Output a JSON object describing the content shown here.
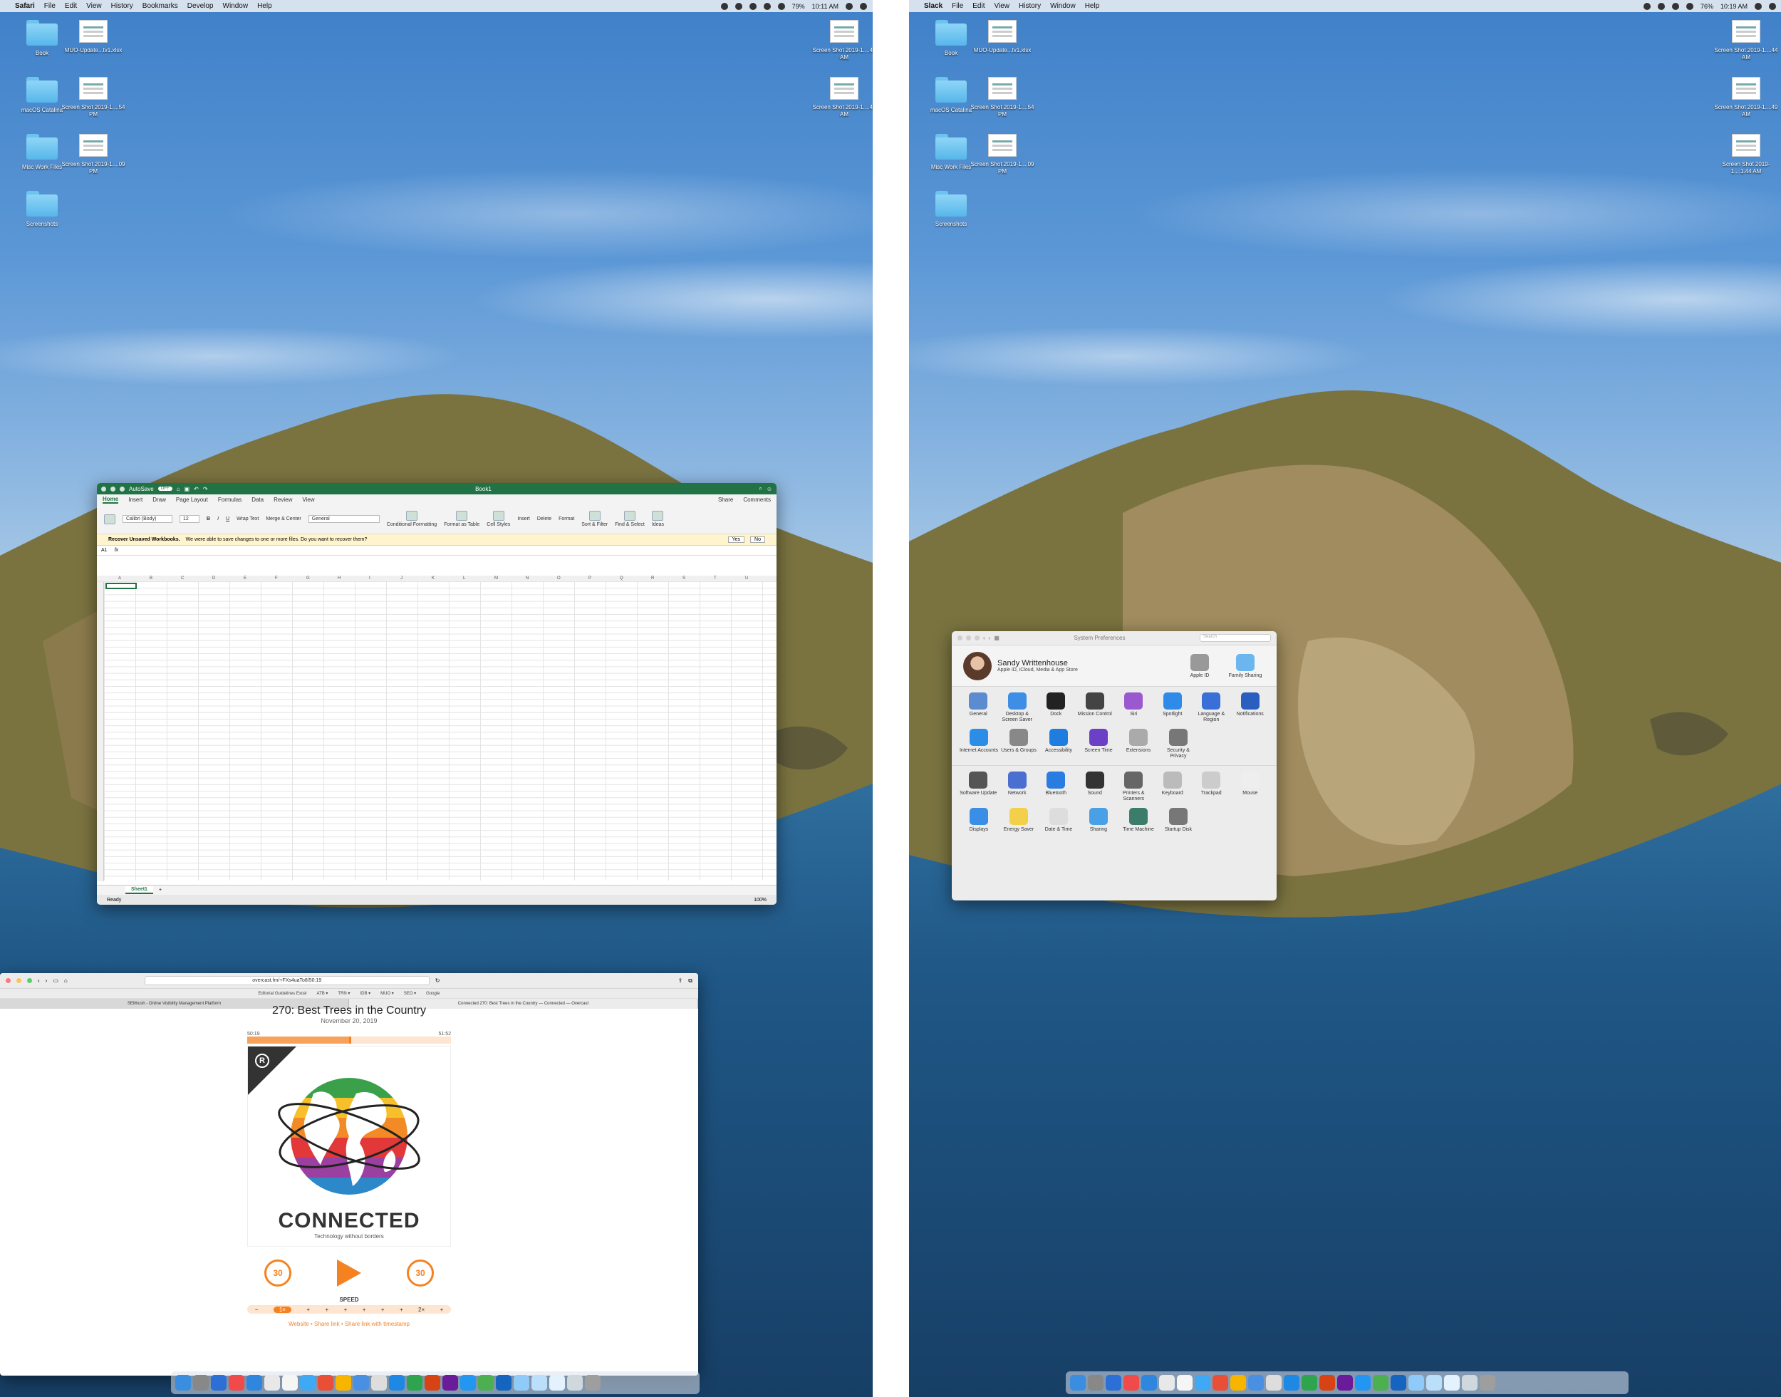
{
  "left": {
    "menubar": {
      "apple": "",
      "app": "Safari",
      "menus": [
        "File",
        "Edit",
        "View",
        "History",
        "Bookmarks",
        "Develop",
        "Window",
        "Help"
      ],
      "battery": "79%",
      "time": "10:11 AM"
    },
    "desktop_icons": [
      {
        "label": "Book",
        "kind": "folder"
      },
      {
        "label": "MUO-Update...tv1.xlsx",
        "kind": "doc"
      },
      {
        "label": "macOS Catalina",
        "kind": "folder"
      },
      {
        "label": "Screen Shot 2019-1....54 PM",
        "kind": "doc"
      },
      {
        "label": "Misc Work Files",
        "kind": "folder"
      },
      {
        "label": "Screen Shot 2019-1....09 PM",
        "kind": "doc"
      },
      {
        "label": "Screenshots",
        "kind": "folder"
      },
      {
        "label": "Screen Shot 2019-1....44 AM",
        "kind": "doc"
      },
      {
        "label": "Screen Shot 2019-1....49 AM",
        "kind": "doc"
      }
    ],
    "excel": {
      "autosave": "AutoSave",
      "autosave_state": "OFF",
      "title": "Book1",
      "tabs": [
        "Home",
        "Insert",
        "Draw",
        "Page Layout",
        "Formulas",
        "Data",
        "Review",
        "View"
      ],
      "share": "Share",
      "comments": "Comments",
      "font": "Calibri (Body)",
      "size": "12",
      "wrap": "Wrap Text",
      "merge": "Merge & Center",
      "number_format": "General",
      "ribbon_groups": [
        "Conditional Formatting",
        "Format as Table",
        "Cell Styles",
        "Insert",
        "Delete",
        "Format",
        "Sort & Filter",
        "Find & Select",
        "Ideas"
      ],
      "info_title": "Recover Unsaved Workbooks.",
      "info_text": "We were able to save changes to one or more files. Do you want to recover them?",
      "yes": "Yes",
      "no": "No",
      "namebox": "A1",
      "fx": "fx",
      "columns": [
        "A",
        "B",
        "C",
        "D",
        "E",
        "F",
        "G",
        "H",
        "I",
        "J",
        "K",
        "L",
        "M",
        "N",
        "O",
        "P",
        "Q",
        "R",
        "S",
        "T",
        "U"
      ],
      "sheet": "Sheet1",
      "status": "Ready",
      "zoom": "100%"
    },
    "safari": {
      "url": "overcast.fm/+FXs4uaTo8/50:19",
      "favorites": [
        "Editorial Guidelines Excel",
        "ATB ▾",
        "TRN ▾",
        "IDB ▾",
        "MUO ▾",
        "SEO ▾",
        "Google"
      ],
      "tabs": [
        "SEMrush - Online Visibility Management Platform",
        "Connected 270: Best Trees in the Country — Connected — Overcast"
      ],
      "episode_title": "270: Best Trees in the Country",
      "date": "November 20, 2019",
      "elapsed": "50:19",
      "remaining": "51:52",
      "progress": 0.5,
      "show": "CONNECTED",
      "tagline": "Technology without borders",
      "skip_back": "30",
      "skip_fwd": "30",
      "speed_label": "SPEED",
      "speed_steps": [
        "−",
        "1×",
        "+",
        "+",
        "+",
        "+",
        "+",
        "+",
        "2×",
        "+"
      ],
      "links": "Website • Share link • Share link with timestamp"
    }
  },
  "right": {
    "menubar": {
      "apple": "",
      "app": "Slack",
      "menus": [
        "File",
        "Edit",
        "View",
        "History",
        "Window",
        "Help"
      ],
      "battery": "76%",
      "time": "10:19 AM"
    },
    "desktop_icons": [
      {
        "label": "Book",
        "kind": "folder"
      },
      {
        "label": "MUO-Update...tv1.xlsx",
        "kind": "doc"
      },
      {
        "label": "macOS Catalina",
        "kind": "folder"
      },
      {
        "label": "Screen Shot 2019-1....54 PM",
        "kind": "doc"
      },
      {
        "label": "Misc Work Files",
        "kind": "folder"
      },
      {
        "label": "Screen Shot 2019-1....09 PM",
        "kind": "doc"
      },
      {
        "label": "Screenshots",
        "kind": "folder"
      },
      {
        "label": "Screen Shot 2019-1....44 AM",
        "kind": "doc"
      },
      {
        "label": "Screen Shot 2019-1....49 AM",
        "kind": "doc"
      },
      {
        "label": "Screen Shot 2019-1....1.44 AM",
        "kind": "doc"
      }
    ],
    "sysprefs": {
      "title": "System Preferences",
      "search": "Search",
      "user_name": "Sandy Writtenhouse",
      "user_sub": "Apple ID, iCloud, Media & App Store",
      "top_items": [
        "Apple ID",
        "Family Sharing"
      ],
      "row1": [
        {
          "label": "General",
          "color": "#5a8ccf"
        },
        {
          "label": "Desktop & Screen Saver",
          "color": "#3e8ee6"
        },
        {
          "label": "Dock",
          "color": "#222"
        },
        {
          "label": "Mission Control",
          "color": "#444"
        },
        {
          "label": "Siri",
          "color": "#9b59d0"
        },
        {
          "label": "Spotlight",
          "color": "#2f8be8"
        },
        {
          "label": "Language & Region",
          "color": "#3a6fd8"
        },
        {
          "label": "Notifications",
          "color": "#2a5fc0"
        }
      ],
      "row2": [
        {
          "label": "Internet Accounts",
          "color": "#2b8de6"
        },
        {
          "label": "Users & Groups",
          "color": "#888"
        },
        {
          "label": "Accessibility",
          "color": "#1f7de0"
        },
        {
          "label": "Screen Time",
          "color": "#6c3fc7"
        },
        {
          "label": "Extensions",
          "color": "#aaa"
        },
        {
          "label": "Security & Privacy",
          "color": "#777"
        }
      ],
      "row3": [
        {
          "label": "Software Update",
          "color": "#555"
        },
        {
          "label": "Network",
          "color": "#4a6fd0"
        },
        {
          "label": "Bluetooth",
          "color": "#2a7de0"
        },
        {
          "label": "Sound",
          "color": "#333"
        },
        {
          "label": "Printers & Scanners",
          "color": "#666"
        },
        {
          "label": "Keyboard",
          "color": "#bbb"
        },
        {
          "label": "Trackpad",
          "color": "#ccc"
        },
        {
          "label": "Mouse",
          "color": "#eee"
        }
      ],
      "row4": [
        {
          "label": "Displays",
          "color": "#3a8ee6"
        },
        {
          "label": "Energy Saver",
          "color": "#f2d04a"
        },
        {
          "label": "Date & Time",
          "color": "#ddd"
        },
        {
          "label": "Sharing",
          "color": "#4aa0e6"
        },
        {
          "label": "Time Machine",
          "color": "#3b7d6a"
        },
        {
          "label": "Startup Disk",
          "color": "#777"
        }
      ]
    }
  }
}
